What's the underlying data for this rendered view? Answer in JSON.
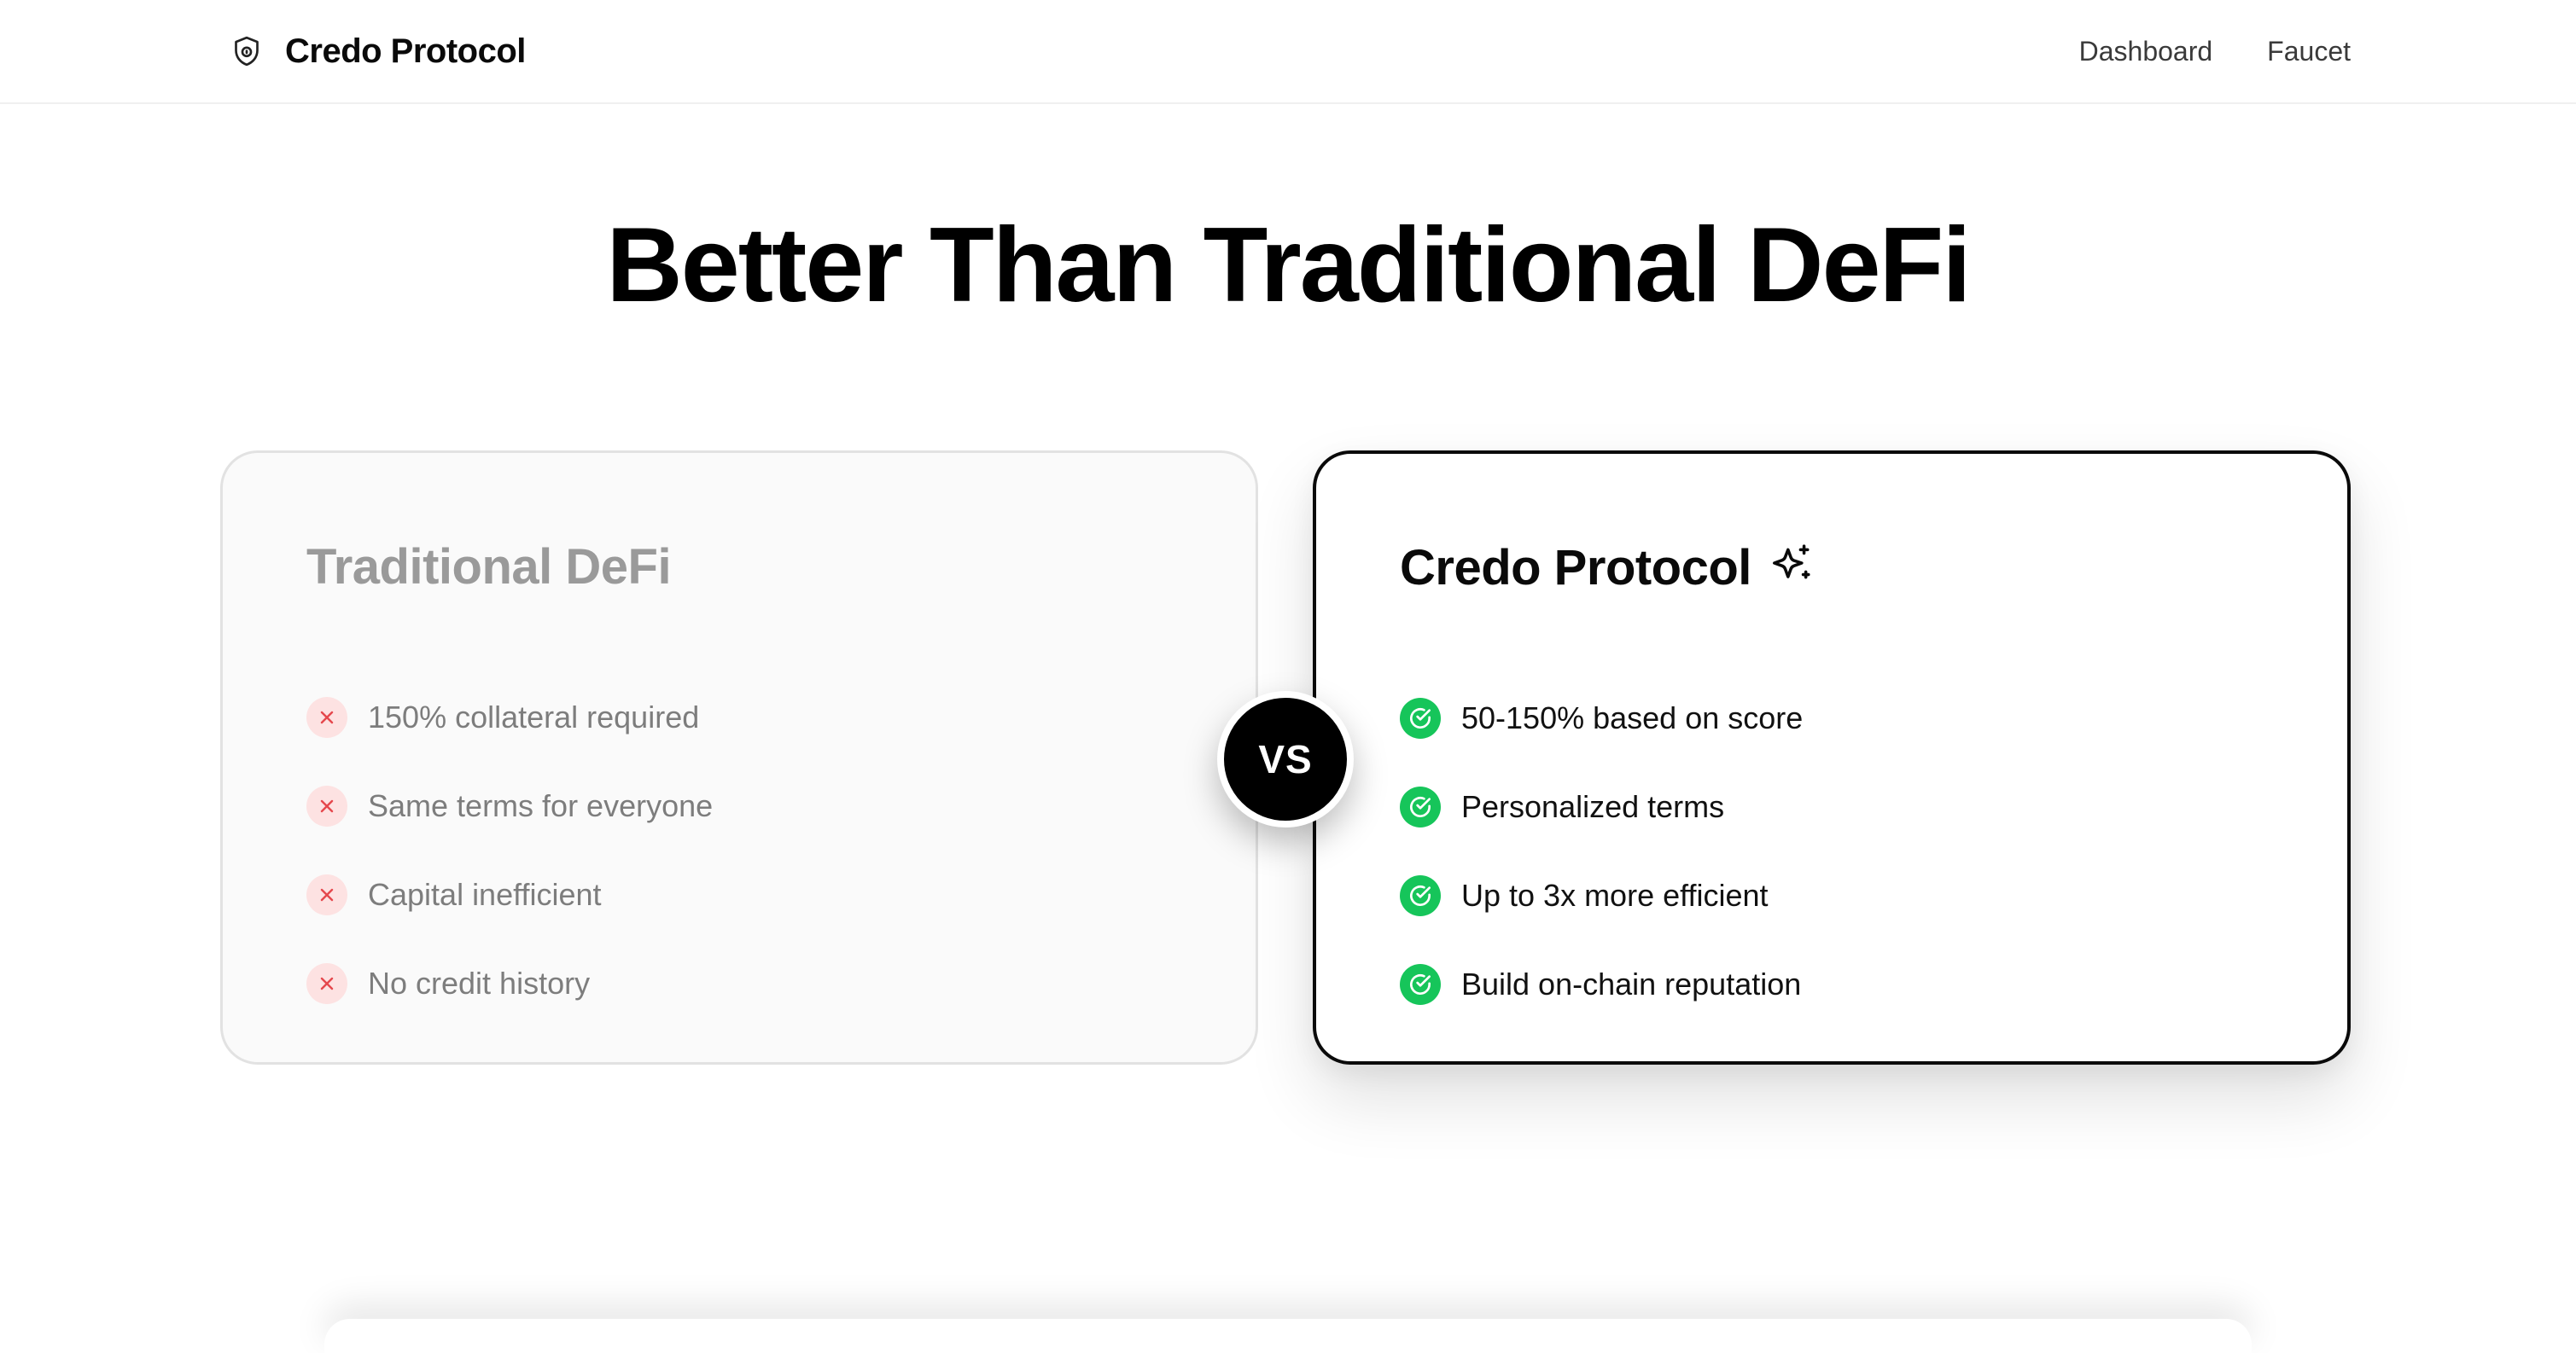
{
  "header": {
    "brand_name": "Credo Protocol",
    "brand_icon": "shield-lock-icon",
    "nav": [
      {
        "label": "Dashboard"
      },
      {
        "label": "Faucet"
      }
    ]
  },
  "hero": {
    "title": "Better Than Traditional DeFi"
  },
  "comparison": {
    "vs_label": "VS",
    "traditional": {
      "title": "Traditional DeFi",
      "item_icon": "x-icon",
      "items": [
        "150% collateral required",
        "Same terms for everyone",
        "Capital inefficient",
        "No credit history"
      ]
    },
    "credo": {
      "title": "Credo Protocol",
      "title_icon": "sparkles-icon",
      "item_icon": "check-circle-icon",
      "items": [
        "50-150% based on score",
        "Personalized terms",
        "Up to 3x more efficient",
        "Build on-chain reputation"
      ]
    }
  },
  "colors": {
    "accent_green": "#16c55a",
    "negative_red": "#e5484d",
    "negative_bg": "#fde2e2",
    "text_primary": "#0a0a0a",
    "text_muted": "#7d7d7d"
  }
}
